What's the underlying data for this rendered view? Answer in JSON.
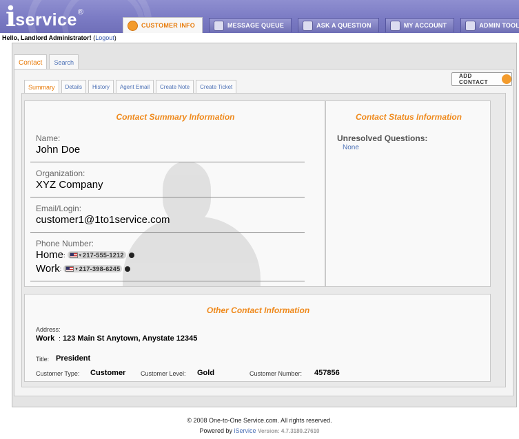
{
  "header": {
    "logo_initial": "i",
    "logo_word": "service",
    "logo_mark": "®",
    "nav": [
      {
        "label": "CUSTOMER INFO",
        "icon": "customer-icon",
        "active": true
      },
      {
        "label": "MESSAGE QUEUE",
        "icon": "queue-icon",
        "active": false
      },
      {
        "label": "ASK A QUESTION",
        "icon": "question-icon",
        "active": false
      },
      {
        "label": "MY ACCOUNT",
        "icon": "account-icon",
        "active": false
      },
      {
        "label": "ADMIN TOOLS",
        "icon": "wrench-icon",
        "active": false
      }
    ]
  },
  "greeting": {
    "text": "Hello, Landlord Administrator!",
    "open_paren": "(",
    "logout": "Logout",
    "close_paren": ")"
  },
  "outer_tabs": [
    "Contact",
    "Search"
  ],
  "inner_tabs": [
    "Summary",
    "Details",
    "History",
    "Agent Email",
    "Create Note",
    "Create Ticket"
  ],
  "add_contact": {
    "label": "ADD CONTACT",
    "icon": "add-contact-icon"
  },
  "summary": {
    "title": "Contact Summary Information",
    "name_label": "Name:",
    "name": "John Doe",
    "org_label": "Organization:",
    "org": "XYZ Company",
    "email_label": "Email/Login:",
    "email": "customer1@1to1service.com",
    "phone_label": "Phone Number:",
    "phones": [
      {
        "kind": "Home",
        "colon": ":",
        "caret": "▾",
        "number": "217-555-1212"
      },
      {
        "kind": "Work",
        "colon": ":",
        "caret": "▾",
        "number": "217-398-6245"
      }
    ]
  },
  "status": {
    "title": "Contact Status Information",
    "unresolved_label": "Unresolved Questions:",
    "unresolved_value": "None"
  },
  "other": {
    "title": "Other Contact Information",
    "address_label": "Address:",
    "address_kind": "Work",
    "address_sep": ":",
    "address_value": "123 Main St Anytown, Anystate 12345",
    "title_label": "Title:",
    "title_value": "President",
    "type_label": "Customer Type:",
    "type_value": "Customer",
    "level_label": "Customer Level:",
    "level_value": "Gold",
    "number_label": "Customer Number:",
    "number_value": "457856"
  },
  "footer": {
    "copyright": "© 2008 One-to-One Service.com. All rights reserved.",
    "powered_by": "Powered by",
    "brand": "iService",
    "version": "Version: 4.7.3180.27610"
  },
  "colors": {
    "accent": "#ef8a1d",
    "header": "#7b7bc4",
    "link": "#4a6fb5"
  }
}
